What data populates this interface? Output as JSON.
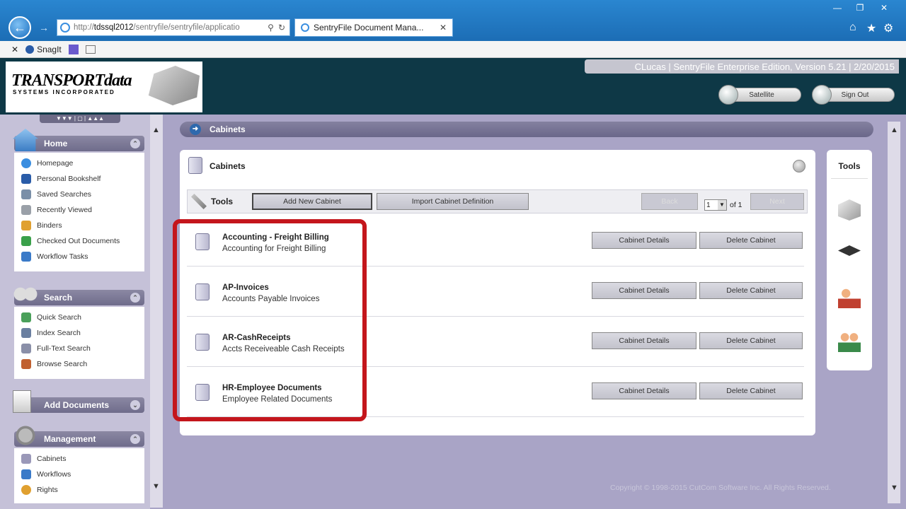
{
  "browser": {
    "address_scheme": "http://",
    "address_domain": "tdssql2012",
    "address_path": "/sentryfile/sentryfile/applicatio",
    "tab_title": "SentryFile Document Mana...",
    "toolbar_snagit": "SnagIt"
  },
  "header": {
    "logo_text": "TRANSPORTdata",
    "logo_sub": "SYSTEMS INCORPORATED",
    "user_info": "CLucas | SentryFile Enterprise Edition, Version 5.21 | 2/20/2015",
    "satellite_label": "Satellite",
    "signout_label": "Sign Out"
  },
  "sidebar": {
    "home": {
      "title": "Home",
      "items": [
        "Homepage",
        "Personal Bookshelf",
        "Saved Searches",
        "Recently Viewed",
        "Binders",
        "Checked Out Documents",
        "Workflow Tasks"
      ]
    },
    "search": {
      "title": "Search",
      "items": [
        "Quick Search",
        "Index Search",
        "Full-Text Search",
        "Browse Search"
      ]
    },
    "add_documents": {
      "title": "Add Documents"
    },
    "management": {
      "title": "Management",
      "items": [
        "Cabinets",
        "Workflows",
        "Rights"
      ]
    }
  },
  "main": {
    "breadcrumb": "Cabinets",
    "card_title": "Cabinets",
    "tools_label": "Tools",
    "add_cabinet_label": "Add New Cabinet",
    "import_label": "Import Cabinet Definition",
    "prev_label": "Back",
    "next_label": "Next",
    "page_value": "1",
    "page_of": "of 1",
    "cabinets": [
      {
        "name": "Accounting - Freight Billing",
        "desc": "Accounting for Freight Billing",
        "details": "Cabinet Details",
        "delete": "Delete Cabinet"
      },
      {
        "name": "AP-Invoices",
        "desc": "Accounts Payable Invoices",
        "details": "Cabinet Details",
        "delete": "Delete Cabinet"
      },
      {
        "name": "AR-CashReceipts",
        "desc": "Accts Receiveable Cash Receipts",
        "details": "Cabinet Details",
        "delete": "Delete Cabinet"
      },
      {
        "name": "HR-Employee Documents",
        "desc": "Employee Related Documents",
        "details": "Cabinet Details",
        "delete": "Delete Cabinet"
      }
    ],
    "annotation_color": "#c4161c"
  },
  "tools_panel": {
    "title": "Tools",
    "icons": [
      "cube-icon",
      "graduation-cap-icon",
      "user-computer-icon",
      "users-icon"
    ]
  },
  "footer": {
    "copyright": "Copyright © 1998-2015 CutCom Software Inc. All Rights Reserved."
  }
}
